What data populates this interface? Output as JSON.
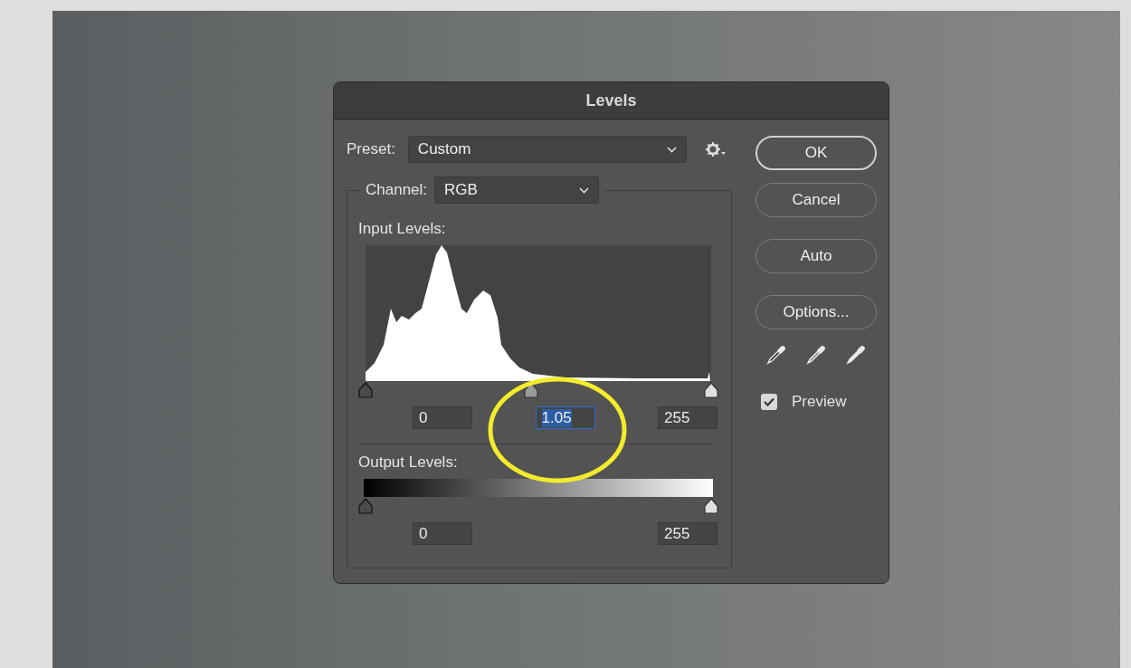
{
  "dialog": {
    "title": "Levels",
    "preset": {
      "label": "Preset:",
      "value": "Custom"
    },
    "channel": {
      "label": "Channel:",
      "value": "RGB"
    },
    "input_levels": {
      "label": "Input Levels:",
      "thumbs": [
        {
          "kind": "black",
          "level": 0
        },
        {
          "kind": "gray",
          "level": 0.48
        },
        {
          "kind": "white",
          "level": 1
        }
      ],
      "fields": [
        {
          "value": "0",
          "selected": false
        },
        {
          "value": "1.05",
          "selected": true
        },
        {
          "value": "255",
          "selected": false
        }
      ]
    },
    "output_levels": {
      "label": "Output Levels:",
      "thumbs": [
        {
          "kind": "black",
          "level": 0
        },
        {
          "kind": "white",
          "level": 1
        }
      ],
      "fields": [
        {
          "value": "0",
          "selected": false
        },
        {
          "value": "255",
          "selected": false
        }
      ]
    },
    "buttons": [
      {
        "label": "OK",
        "default": true
      },
      {
        "label": "Cancel",
        "default": false
      },
      {
        "label": "Auto",
        "default": false
      },
      {
        "label": "Options...",
        "default": false
      }
    ],
    "eyedroppers": [
      {
        "kind": "black"
      },
      {
        "kind": "gray"
      },
      {
        "kind": "white"
      }
    ],
    "preview": {
      "label": "Preview",
      "checked": true
    }
  },
  "annotation": {
    "kind": "ellipse",
    "color": "#f2ec2c"
  }
}
